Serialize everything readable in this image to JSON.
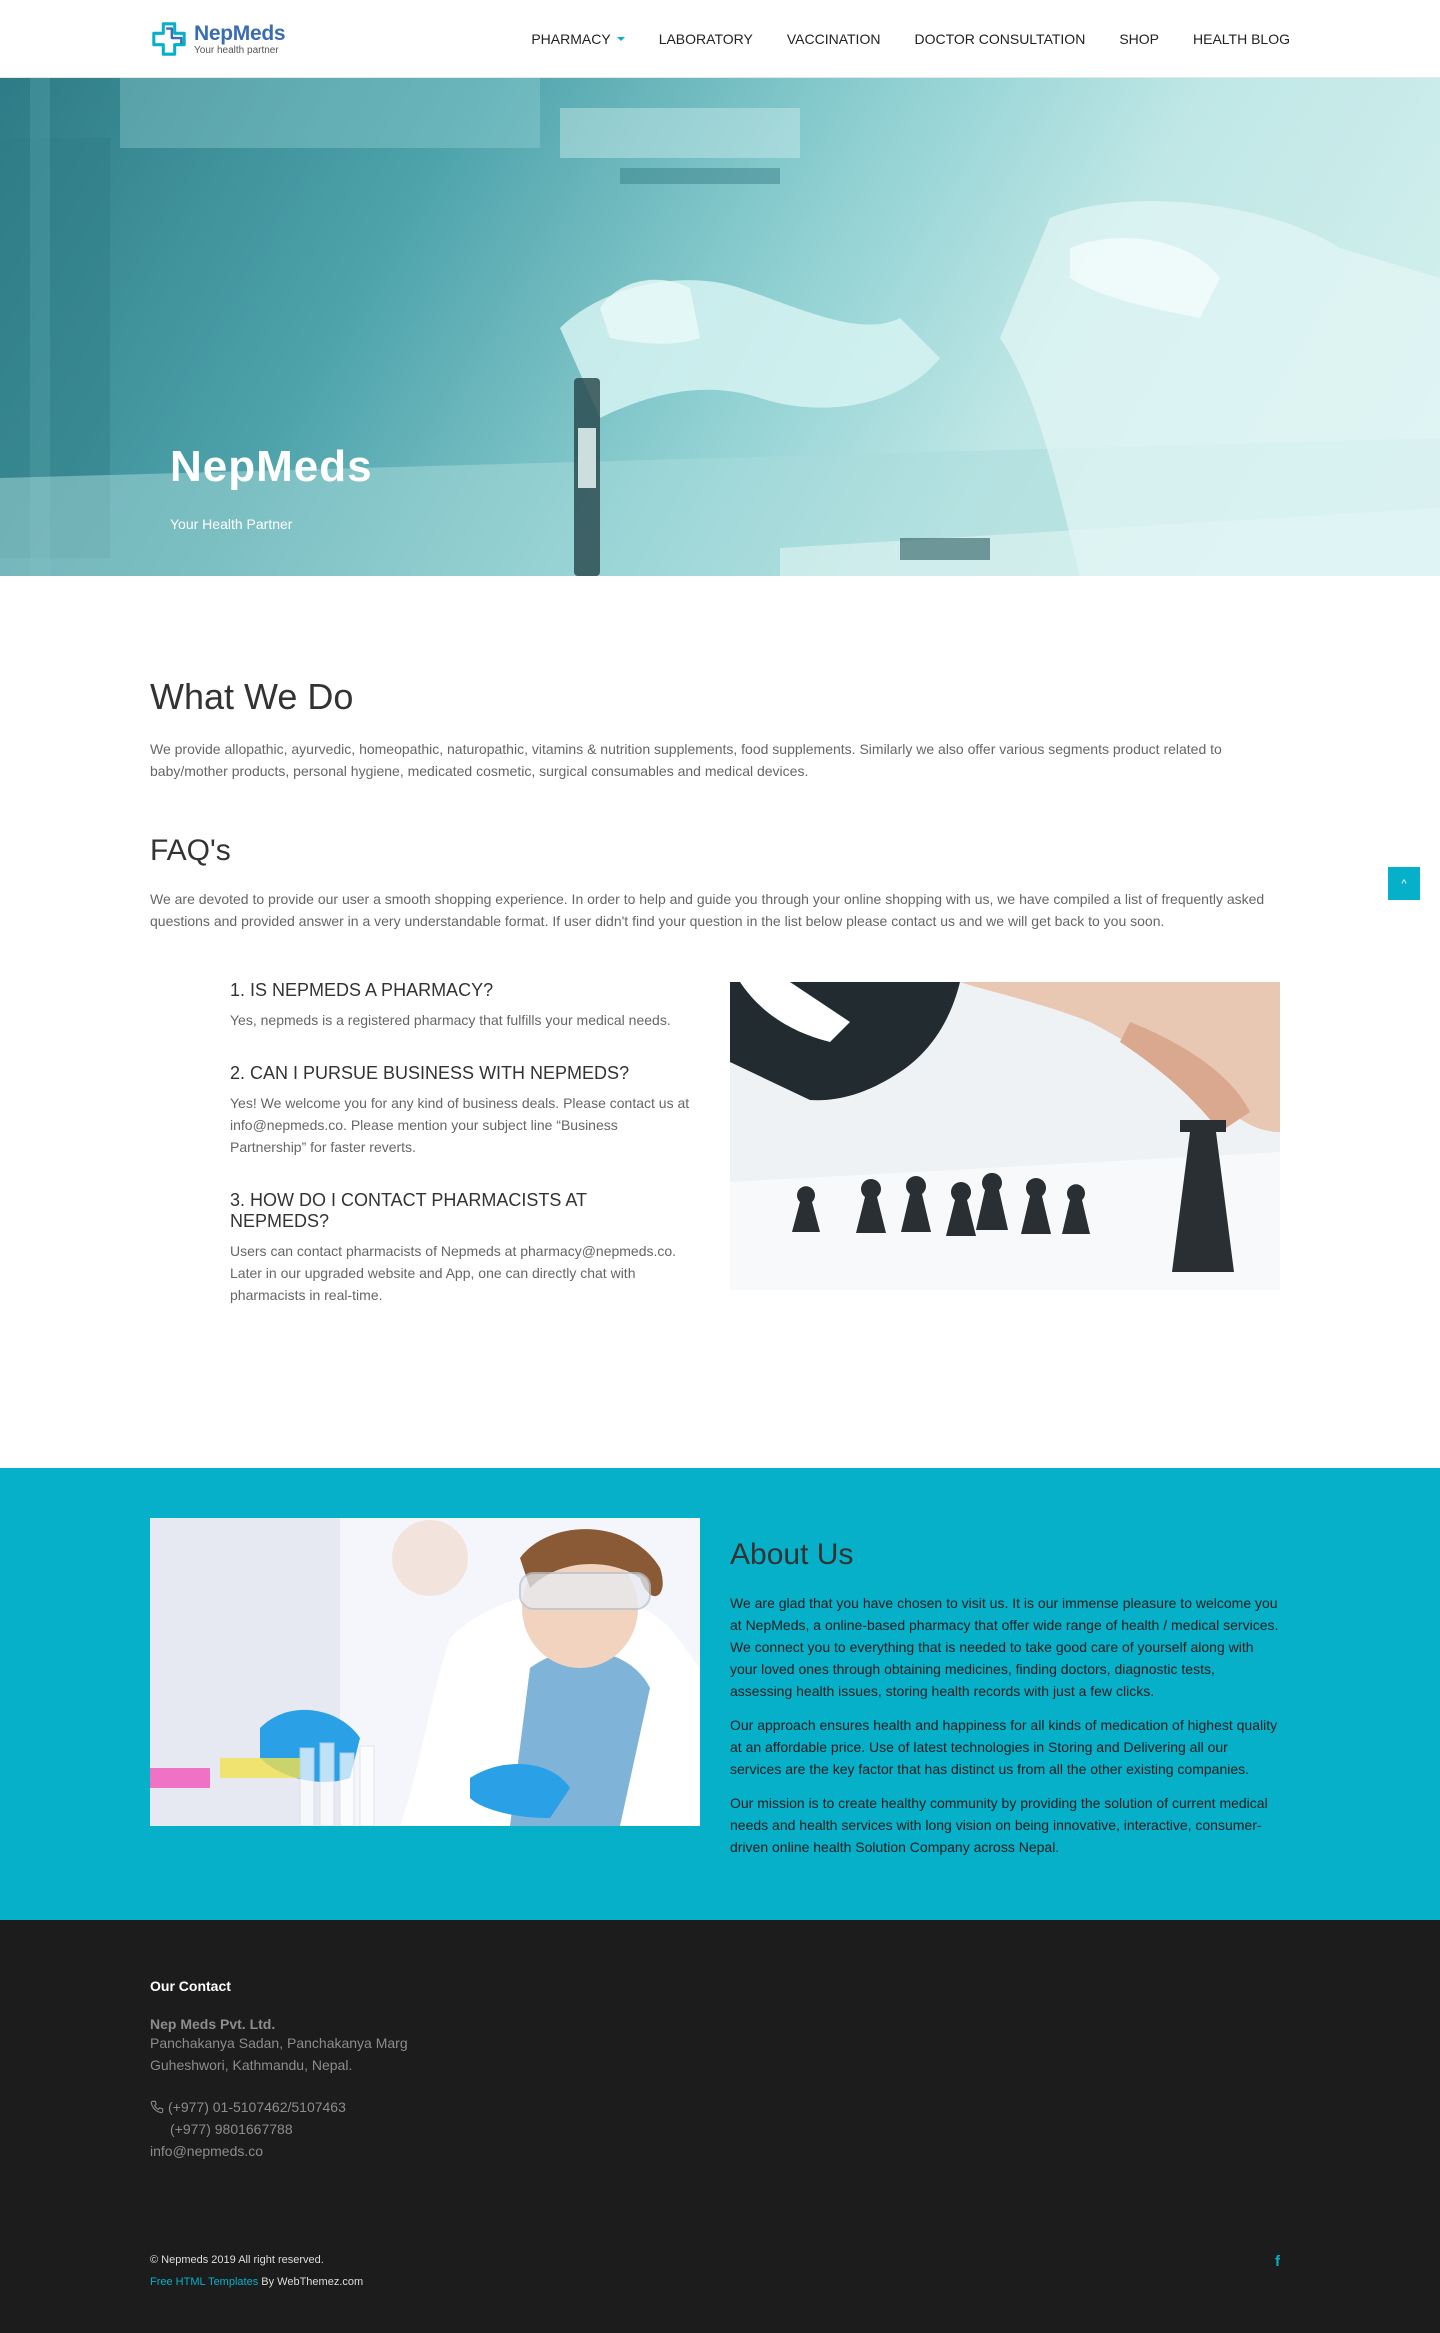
{
  "brand": {
    "name": "NepMeds",
    "tagline": "Your health partner",
    "accent": "#06b0c9",
    "logo_blue": "#3a6cb3"
  },
  "nav": {
    "items": [
      {
        "label": "PHARMACY",
        "dropdown": true
      },
      {
        "label": "LABORATORY"
      },
      {
        "label": "VACCINATION"
      },
      {
        "label": "DOCTOR CONSULTATION"
      },
      {
        "label": "SHOP"
      },
      {
        "label": "HEALTH BLOG"
      }
    ]
  },
  "hero": {
    "title": "NepMeds",
    "subtitle": "Your Health Partner"
  },
  "what": {
    "title": "What We Do",
    "text": "We provide allopathic, ayurvedic, homeopathic, naturopathic, vitamins & nutrition supplements, food supplements. Similarly we also offer various segments product related to baby/mother products, personal hygiene, medicated cosmetic, surgical consumables and medical devices."
  },
  "faq": {
    "title": "FAQ's",
    "intro": "We are devoted to provide our user a smooth shopping experience. In order to help and guide you through your online shopping with us, we have compiled a list of frequently asked questions and provided answer in a very understandable format. If user didn't find your question in the list below please contact us and we will get back to you soon.",
    "items": [
      {
        "q": "1. IS NEPMEDS A PHARMACY?",
        "a": "Yes, nepmeds is a registered pharmacy that fulfills your medical needs."
      },
      {
        "q": "2. CAN I PURSUE BUSINESS WITH NEPMEDS?",
        "a": "Yes! We welcome you for any kind of business deals. Please contact us at info@nepmeds.co. Please mention your subject line “Business Partnership” for faster reverts."
      },
      {
        "q": "3. HOW DO I CONTACT PHARMACISTS AT NEPMEDS?",
        "a": "Users can contact pharmacists of Nepmeds at pharmacy@nepmeds.co. Later in our upgraded website and App, one can directly chat with pharmacists in real-time."
      }
    ]
  },
  "back_to_top": {
    "icon": "chevron-up-icon",
    "glyph": "^"
  },
  "about": {
    "title": "About Us",
    "paragraphs": [
      "We are glad that you have chosen to visit us. It is our immense pleasure to welcome you at NepMeds, a online-based pharmacy that offer wide range of health / medical services. We connect you to everything that is needed to take good care of yourself along with your loved ones through obtaining medicines, finding doctors, diagnostic tests, assessing health issues, storing health records with just a few clicks.",
      "Our approach ensures health and happiness for all kinds of medication of highest quality at an affordable price. Use of latest technologies in Storing and Delivering all our services are the key factor that has distinct us from all the other existing companies.",
      "Our mission is to create healthy community by providing the solution of current medical needs and health services with long vision on being innovative, interactive, consumer-driven online health Solution Company across Nepal."
    ]
  },
  "footer": {
    "heading": "Our Contact",
    "company": "Nep Meds Pvt. Ltd.",
    "address1": "Panchakanya Sadan, Panchakanya Marg",
    "address2": "Guheshwori, Kathmandu, Nepal.",
    "phone1": "(+977) 01-5107462/5107463",
    "phone2": "(+977) 9801667788",
    "email": "info@nepmeds.co",
    "copyright": "© Nepmeds 2019 All right reserved.",
    "templates_link": "Free HTML Templates",
    "by": "By WebThemez.com",
    "social": "f"
  }
}
